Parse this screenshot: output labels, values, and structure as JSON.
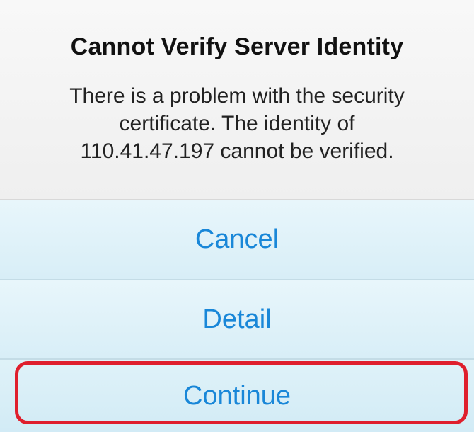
{
  "dialog": {
    "title": "Cannot Verify Server Identity",
    "message": "There is a problem with the security certificate. The identity of 110.41.47.197 cannot be verified.",
    "actions": [
      {
        "label": "Cancel"
      },
      {
        "label": "Detail"
      },
      {
        "label": "Continue"
      }
    ]
  },
  "colors": {
    "action_text": "#1987d8",
    "highlight": "#df1f2d"
  }
}
